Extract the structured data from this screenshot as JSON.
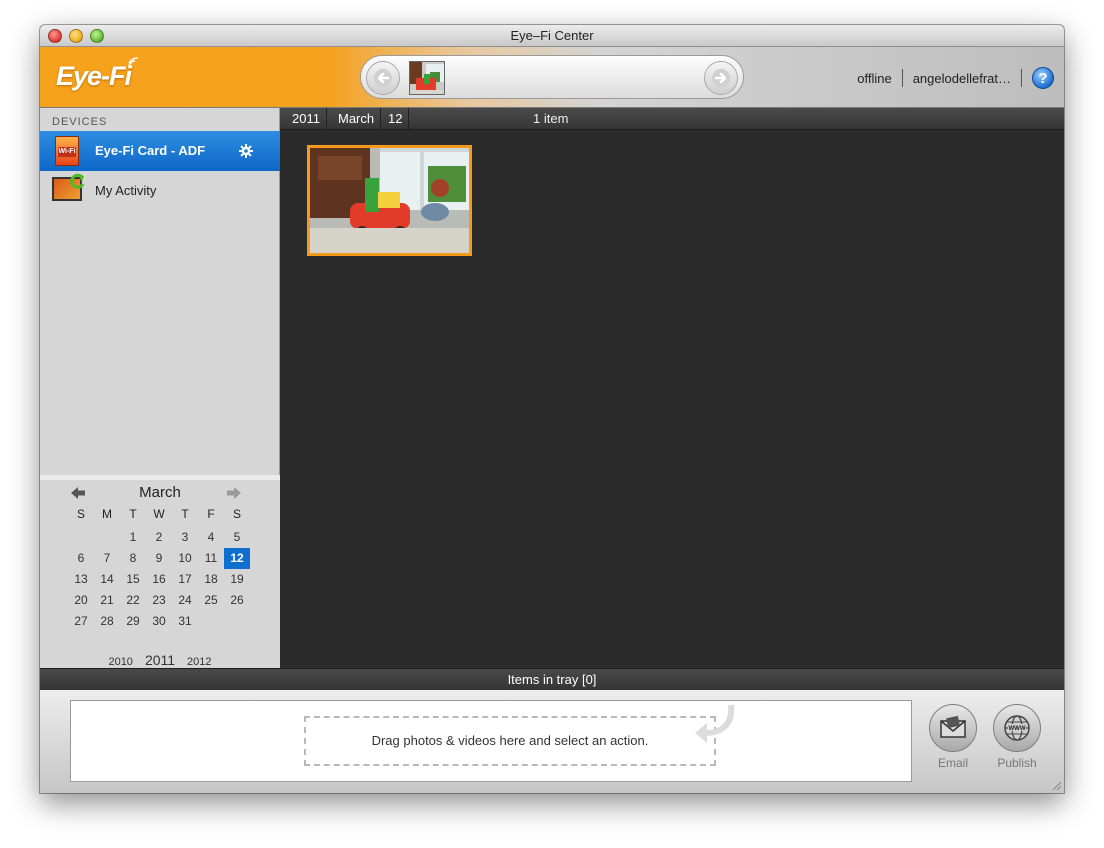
{
  "window": {
    "title": "Eye–Fi Center"
  },
  "header": {
    "logo_text": "Eye-Fi",
    "status": "offline",
    "username": "angelodellefrat…",
    "help_label": "?"
  },
  "sidebar": {
    "section_label": "DEVICES",
    "items": [
      {
        "label": "Eye-Fi Card - ADF",
        "icon": "wifi-card-icon",
        "selected": true
      },
      {
        "label": "My Activity",
        "icon": "activity-icon",
        "selected": false
      }
    ],
    "card_icon_text": "Wi-Fi"
  },
  "calendar": {
    "month": "March",
    "weekdays": [
      "S",
      "M",
      "T",
      "W",
      "T",
      "F",
      "S"
    ],
    "weeks": [
      [
        "",
        "",
        "1",
        "2",
        "3",
        "4",
        "5"
      ],
      [
        "6",
        "7",
        "8",
        "9",
        "10",
        "11",
        "12"
      ],
      [
        "13",
        "14",
        "15",
        "16",
        "17",
        "18",
        "19"
      ],
      [
        "20",
        "21",
        "22",
        "23",
        "24",
        "25",
        "26"
      ],
      [
        "27",
        "28",
        "29",
        "30",
        "31",
        "",
        ""
      ]
    ],
    "selected_day": "12",
    "years": {
      "prev": "2010",
      "current": "2011",
      "next": "2012"
    }
  },
  "breadcrumb": {
    "year": "2011",
    "month": "March",
    "day": "12"
  },
  "main": {
    "item_count": "1 item"
  },
  "tray": {
    "title": "Items in tray [0]",
    "drop_hint": "Drag photos & videos here and select an action.",
    "actions": {
      "email": "Email",
      "publish": "Publish"
    }
  },
  "colors": {
    "accent_orange": "#f59a1a",
    "selection_blue": "#0e6fce",
    "content_bg": "#2b2b2b",
    "sidebar_bg": "#d6d6d6"
  }
}
